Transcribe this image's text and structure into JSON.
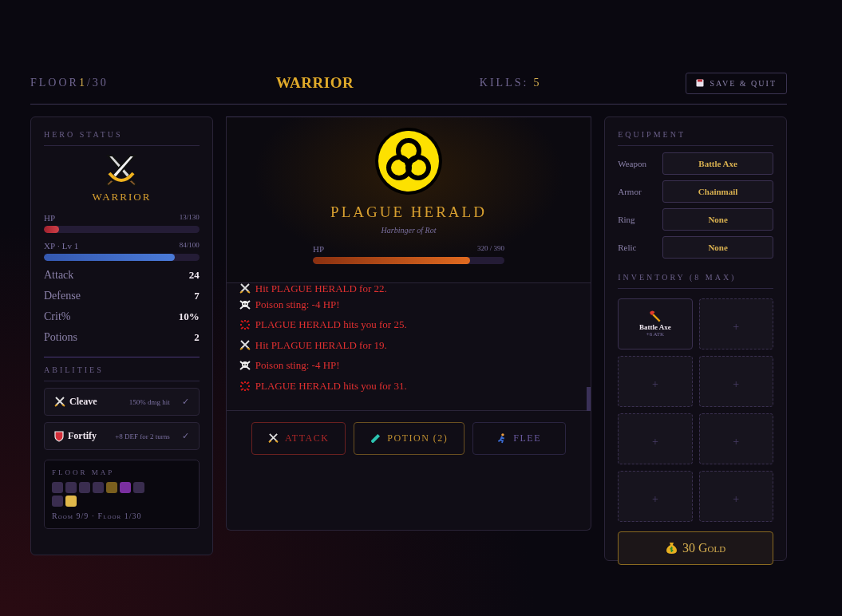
{
  "header": {
    "floor_label": "FLOOR",
    "floor_value": "1",
    "floor_total": "/30",
    "title": "WARRIOR",
    "kills_label": "KILLS:",
    "kills_value": "5",
    "save_button": "SAVE & QUIT"
  },
  "hero": {
    "heading": "HERO STATUS",
    "class_name": "WARRIOR",
    "bars": [
      {
        "kind": "hp",
        "label": "HP",
        "reading": "13/130",
        "level": 0.1
      },
      {
        "kind": "xp",
        "label": "XP · Lv 1",
        "reading": "84/100",
        "level": 0.84
      }
    ],
    "stats": [
      {
        "label": "Attack",
        "value": "24"
      },
      {
        "label": "Defense",
        "value": "7"
      },
      {
        "label": "Crit%",
        "value": "10%"
      },
      {
        "label": "Potions",
        "value": "2"
      }
    ],
    "abilities_heading": "ABILITIES",
    "abilities": [
      {
        "kind": "cleave",
        "name": "Cleave",
        "effect": "150% dmg hit",
        "mark": "✓"
      },
      {
        "kind": "fortify",
        "name": "Fortify",
        "effect": "+8 DEF for 2 turns",
        "mark": "✓"
      }
    ],
    "floor_map": {
      "heading": "FLOOR MAP",
      "rooms": [
        {
          "color": "#3a2d4f"
        },
        {
          "color": "#3a2d4f"
        },
        {
          "color": "#3a2d4f"
        },
        {
          "color": "#3a2d4f"
        },
        {
          "color": "#7a5f1e"
        },
        {
          "color": "#7a2fa0"
        },
        {
          "color": "#3a2d4f"
        },
        {
          "color": "#3a2d4f"
        },
        {
          "color": "#e0b84a"
        }
      ],
      "caption": "Room 9/9 · Floor 1/30"
    }
  },
  "enemy": {
    "name": "PLAGUE HERALD",
    "subtitle": "Harbinger of Rot",
    "hp_label": "HP",
    "hp_reading": "320 / 390",
    "level": 0.82
  },
  "log": [
    {
      "kind": "hit",
      "text": "Hit PLAGUE HERALD for 22."
    },
    {
      "kind": "poison",
      "text": "Poison sting: -4 HP!"
    },
    {
      "kind": "enemy",
      "text": "PLAGUE HERALD hits you for 25."
    },
    {
      "kind": "hit",
      "text": "Hit PLAGUE HERALD for 19."
    },
    {
      "kind": "poison",
      "text": "Poison sting: -4 HP!"
    },
    {
      "kind": "enemy",
      "text": "PLAGUE HERALD hits you for 31."
    }
  ],
  "actions": [
    {
      "kind": "attack",
      "label": "ATTACK"
    },
    {
      "kind": "potion",
      "label": "POTION (2)"
    },
    {
      "kind": "flee",
      "label": "FLEE"
    }
  ],
  "equipment": {
    "heading": "EQUIPMENT",
    "slots": [
      {
        "label": "Weapon",
        "value": "Battle Axe"
      },
      {
        "label": "Armor",
        "value": "Chainmail"
      },
      {
        "label": "Ring",
        "value": "None"
      },
      {
        "label": "Relic",
        "value": "None"
      }
    ]
  },
  "inventory": {
    "heading": "INVENTORY (8 MAX)",
    "slots": [
      {
        "kind": "item",
        "name": "Battle Axe",
        "bonus": "+6 ATK"
      },
      {
        "kind": "empty",
        "mark": "+"
      },
      {
        "kind": "empty",
        "mark": "+"
      },
      {
        "kind": "empty",
        "mark": "+"
      },
      {
        "kind": "empty",
        "mark": "+"
      },
      {
        "kind": "empty",
        "mark": "+"
      },
      {
        "kind": "empty",
        "mark": "+"
      },
      {
        "kind": "empty",
        "mark": "+"
      }
    ]
  },
  "gold": "30 Gold"
}
